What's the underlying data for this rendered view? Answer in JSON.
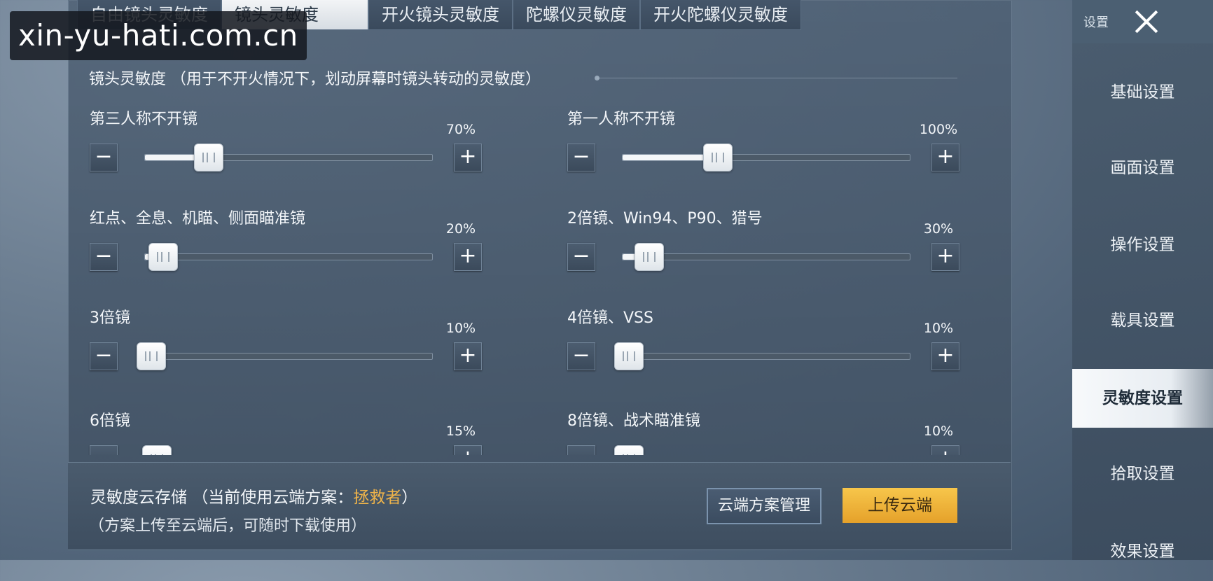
{
  "watermark": "xin-yu-hati.com.cn",
  "tabs": [
    {
      "label": "自由镜头灵敏度",
      "active": false
    },
    {
      "label": "镜头灵敏度",
      "active": true
    },
    {
      "label": "开火镜头灵敏度",
      "active": false
    },
    {
      "label": "陀螺仪灵敏度",
      "active": false
    },
    {
      "label": "开火陀螺仪灵敏度",
      "active": false
    }
  ],
  "section_header": "镜头灵敏度  （用于不开火情况下，划动屏幕时镜头转动的灵敏度）",
  "settings": [
    {
      "label": "第三人称不开镜",
      "value_text": "70%",
      "value": 0.22,
      "show_fill": true
    },
    {
      "label": "第一人称不开镜",
      "value_text": "100%",
      "value": 0.33,
      "show_fill": true
    },
    {
      "label": "红点、全息、机瞄、侧面瞄准镜",
      "value_text": "20%",
      "value": 0.06,
      "show_fill": true
    },
    {
      "label": "2倍镜、Win94、P90、猎号",
      "value_text": "30%",
      "value": 0.09,
      "show_fill": true
    },
    {
      "label": "3倍镜",
      "value_text": "10%",
      "value": 0.02,
      "show_fill": false
    },
    {
      "label": "4倍镜、VSS",
      "value_text": "10%",
      "value": 0.02,
      "show_fill": false
    },
    {
      "label": "6倍镜",
      "value_text": "15%",
      "value": 0.04,
      "show_fill": false
    },
    {
      "label": "8倍镜、战术瞄准镜",
      "value_text": "10%",
      "value": 0.02,
      "show_fill": false
    }
  ],
  "controls": {
    "minus": "−",
    "plus": "+"
  },
  "cloud": {
    "title_prefix": "灵敏度云存储 （当前使用云端方案：",
    "scheme_name": "拯救者",
    "title_suffix": "）",
    "subtitle": "（方案上传至云端后，可随时下载使用）",
    "manage_button": "云端方案管理",
    "upload_button": "上传云端"
  },
  "sidebar": {
    "title": "设置",
    "items": [
      {
        "label": "基础设置",
        "active": false
      },
      {
        "label": "画面设置",
        "active": false
      },
      {
        "label": "操作设置",
        "active": false
      },
      {
        "label": "载具设置",
        "active": false
      },
      {
        "label": "灵敏度设置",
        "active": true
      },
      {
        "label": "拾取设置",
        "active": false
      },
      {
        "label": "效果设置",
        "active": false
      }
    ]
  },
  "colors": {
    "accent": "#f0b44a",
    "upload_button": "#f2b43a",
    "active_tab": "#e9edf1"
  }
}
